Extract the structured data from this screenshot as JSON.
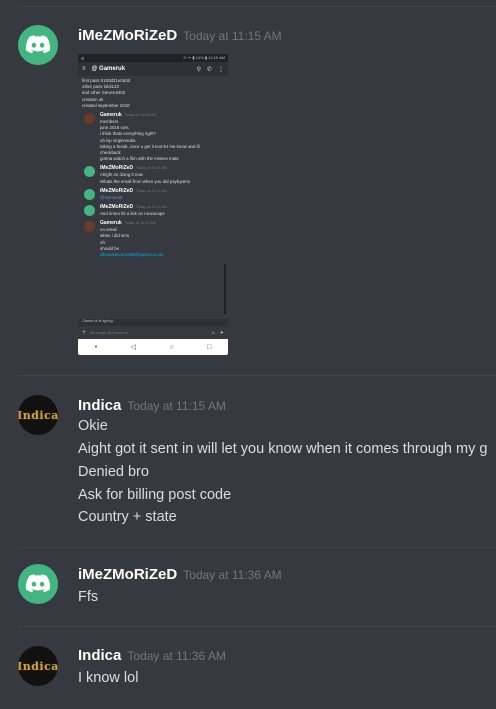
{
  "colors": {
    "background": "#36393f",
    "username": "#ffffff",
    "timestamp": "#72767d",
    "text": "#dcddde",
    "discord_green": "#43b581"
  },
  "messages": [
    {
      "username": "iMeZMoRiZeD",
      "timestamp": "Today at 11:15 AM",
      "avatar_icon": "discord-logo-icon",
      "attachment": {
        "status_bar_right": "⊙ ᯤ ▮ 14% ▮ 11:15 AM",
        "channel": "@ Gameruk",
        "lines_top": [
          "first pass 0100d21e0a3d",
          "other pass lolol123",
          "and other Steven3402",
          "creation uk",
          "created september 2010"
        ],
        "posts": [
          {
            "author": "Gameruk",
            "time": "Today at 10:58 AM",
            "avatar": "g",
            "lines": [
              "members",
              "june 2018 sms",
              "i think thats everything right?",
              "oh isp virginmedia",
              "taking a break, once u get it text let me know and ill",
              "checkback",
              "gonna watch a film with the misses mate"
            ]
          },
          {
            "author": "iMeZMoRiZeD",
            "time": "Today at 11:01 AM",
            "avatar": "d",
            "lines": [
              "Alright im doing it now",
              "Whats the email from when you did paybyams"
            ]
          },
          {
            "author": "iMeZMoRiZeD",
            "time": "Today at 11:14 AM",
            "avatar": "d",
            "lines": [
              "@Gameruk"
            ],
            "mention": true
          },
          {
            "author": "iMeZMoRiZeD",
            "time": "Today at 11:14 AM",
            "avatar": "d",
            "lines": [
              "And imma hit a lick on runescape"
            ]
          },
          {
            "author": "Gameruk",
            "time": "Today at 11:14 AM",
            "avatar": "g",
            "lines": [
              "no email",
              "when i did sms",
              "oh",
              "should be"
            ],
            "link": "allsoutsteven1992@yahoo.co.uk"
          }
        ],
        "typing": "Gameruk is typing...",
        "input_placeholder": "Message @Gameruk",
        "nav": [
          "•",
          "◁",
          "○",
          "□"
        ]
      }
    },
    {
      "username": "Indica",
      "timestamp": "Today at 11:15 AM",
      "avatar_icon": "indica-avatar",
      "avatar_text": "Indica",
      "lines": [
        "Okie",
        "Aight got it sent in will let you know when it comes through my g",
        "Denied bro",
        "Ask for billing post code",
        "Country + state"
      ]
    },
    {
      "username": "iMeZMoRiZeD",
      "timestamp": "Today at 11:36 AM",
      "avatar_icon": "discord-logo-icon",
      "lines": [
        "Ffs"
      ]
    },
    {
      "username": "Indica",
      "timestamp": "Today at 11:36 AM",
      "avatar_icon": "indica-avatar",
      "avatar_text": "Indica",
      "lines": [
        "I know lol"
      ]
    }
  ]
}
